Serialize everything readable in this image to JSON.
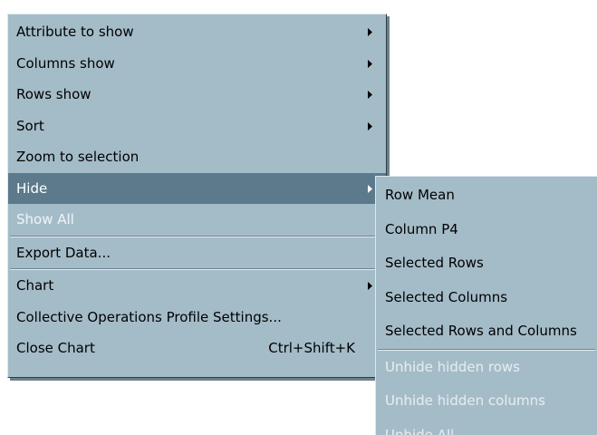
{
  "main_menu": {
    "items": [
      {
        "label": "Attribute to show",
        "submenu": true
      },
      {
        "label": "Columns show",
        "submenu": true
      },
      {
        "label": "Rows show",
        "submenu": true
      },
      {
        "label": "Sort",
        "submenu": true
      },
      {
        "label": "Zoom to selection"
      },
      {
        "label": "Hide",
        "submenu": true,
        "selected": true
      },
      {
        "label": "Show All",
        "disabled": true
      },
      {
        "label": "Export Data..."
      },
      {
        "label": "Chart",
        "submenu": true
      },
      {
        "label": "Collective Operations Profile Settings..."
      },
      {
        "label": "Close Chart",
        "shortcut": "Ctrl+Shift+K"
      }
    ]
  },
  "hide_submenu": {
    "items": [
      {
        "label": "Row Mean"
      },
      {
        "label": "Column P4"
      },
      {
        "label": "Selected Rows"
      },
      {
        "label": "Selected Columns"
      },
      {
        "label": "Selected Rows and Columns"
      },
      {
        "label": "Unhide hidden rows",
        "disabled": true
      },
      {
        "label": "Unhide hidden columns",
        "disabled": true
      },
      {
        "label": "Unhide All",
        "disabled": true
      }
    ]
  },
  "icons": {
    "submenu_arrow": "triangle-right-icon"
  },
  "colors": {
    "menu_background": "#a4bcc8",
    "selected_background": "#5c7a8c",
    "selected_text": "#ffffff",
    "disabled_text": "#e8f0f4"
  }
}
